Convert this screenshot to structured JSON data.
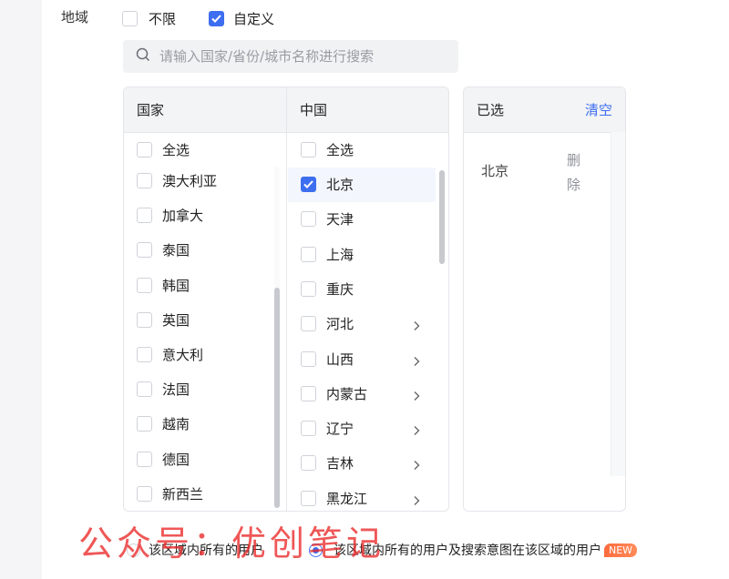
{
  "region": {
    "label": "地域",
    "modes": [
      {
        "label": "不限",
        "checked": false
      },
      {
        "label": "自定义",
        "checked": true
      }
    ]
  },
  "search": {
    "placeholder": "请输入国家/省份/城市名称进行搜索",
    "value": ""
  },
  "country_panel": {
    "header": "国家",
    "select_all": "全选",
    "items": [
      "澳大利亚",
      "加拿大",
      "泰国",
      "韩国",
      "英国",
      "意大利",
      "法国",
      "越南",
      "德国",
      "新西兰"
    ]
  },
  "province_panel": {
    "header": "中国",
    "select_all": "全选",
    "items": [
      {
        "label": "北京",
        "checked": true,
        "has_children": false
      },
      {
        "label": "天津",
        "checked": false,
        "has_children": false
      },
      {
        "label": "上海",
        "checked": false,
        "has_children": false
      },
      {
        "label": "重庆",
        "checked": false,
        "has_children": false
      },
      {
        "label": "河北",
        "checked": false,
        "has_children": true
      },
      {
        "label": "山西",
        "checked": false,
        "has_children": true
      },
      {
        "label": "内蒙古",
        "checked": false,
        "has_children": true
      },
      {
        "label": "辽宁",
        "checked": false,
        "has_children": true
      },
      {
        "label": "吉林",
        "checked": false,
        "has_children": true
      },
      {
        "label": "黑龙江",
        "checked": false,
        "has_children": true
      }
    ]
  },
  "selected_panel": {
    "header": "已选",
    "clear_label": "清空",
    "items": [
      {
        "label": "北京",
        "delete_label": "删除"
      }
    ]
  },
  "target_options": [
    {
      "label": "该区域内所有的用户",
      "selected": false
    },
    {
      "label": "该区域内所有的用户及搜索意图在该区域的用户",
      "selected": true,
      "badge": "NEW"
    }
  ],
  "watermark": "公众号：优创笔记",
  "colors": {
    "accent": "#3d6ef0",
    "badge": "#ff6b3d",
    "watermark": "#eb2828"
  }
}
